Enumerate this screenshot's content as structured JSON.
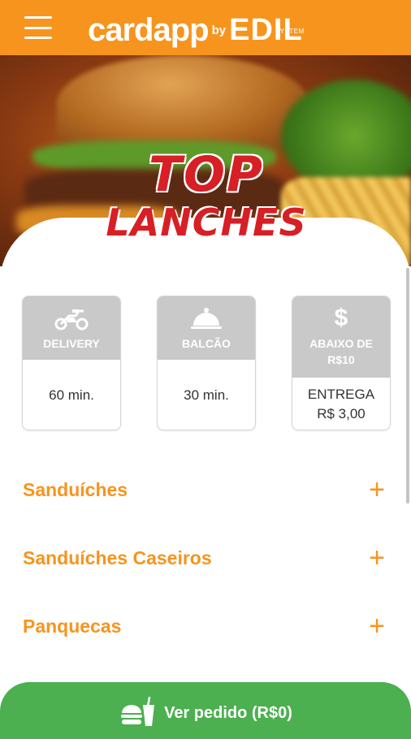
{
  "header": {
    "brand_main": "cardapp",
    "brand_by": "by",
    "brand_edil": "EDIL",
    "brand_system": "SYSTEM",
    "background_color": "#f7941d"
  },
  "restaurant": {
    "logo_line1": "TOP",
    "logo_line2": "LANCHES",
    "logo_color": "#d71f26"
  },
  "services": [
    {
      "icon": "motorcycle-icon",
      "label": "DELIVERY",
      "value_line1": "60 min.",
      "value_line2": ""
    },
    {
      "icon": "cloche-icon",
      "label": "BALCÃO",
      "value_line1": "30 min.",
      "value_line2": ""
    },
    {
      "icon": "dollar-icon",
      "icon_glyph": "$",
      "label": "ABAIXO DE R$10",
      "value_line1": "ENTREGA",
      "value_line2": "R$ 3,00"
    }
  ],
  "categories": [
    {
      "label": "Sanduíches",
      "action": "+"
    },
    {
      "label": "Sanduíches Caseiros",
      "action": "+"
    },
    {
      "label": "Panquecas",
      "action": "+"
    }
  ],
  "order_button": {
    "label": "Ver pedido (R$0)",
    "icon": "burger-drink-icon",
    "color": "#4caf50"
  },
  "accent_color": "#f7941d"
}
